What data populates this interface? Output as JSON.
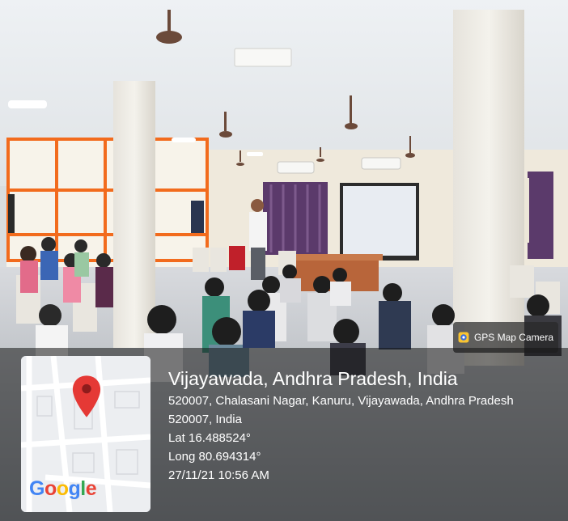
{
  "badge": {
    "label": "GPS Map Camera",
    "icon": "gps-map-camera-icon"
  },
  "location": {
    "title": "Vijayawada, Andhra Pradesh, India",
    "address_line1": "520007, Chalasani Nagar, Kanuru, Vijayawada, Andhra Pradesh",
    "address_line2": "520007, India",
    "lat": "Lat 16.488524°",
    "long": "Long 80.694314°",
    "datetime": "27/11/21 10:56 AM"
  },
  "map": {
    "logo": {
      "letters": [
        "G",
        "o",
        "o",
        "g",
        "l",
        "e"
      ],
      "colors": [
        "#4285F4",
        "#EA4335",
        "#FBBC05",
        "#4285F4",
        "#34A853",
        "#EA4335"
      ]
    },
    "pin_color": "#E53935",
    "pin_icon": "map-pin-icon"
  },
  "colors": {
    "wall_accent": "#F26B1D",
    "curtain": "#5B3A6B",
    "screen": "#E8ECF2"
  }
}
